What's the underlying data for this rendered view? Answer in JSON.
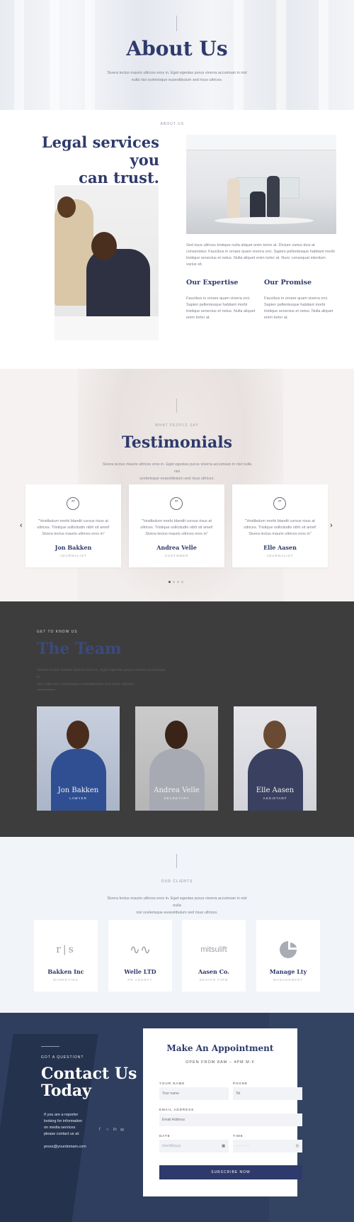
{
  "hero": {
    "title": "About Us",
    "subtitle_line1": "Sivera lectus mauris ultrices eros in. Eget egestas purus viverra accumsan in nisl",
    "subtitle_line2": "nulla nisi scelerisque eusestibulum sed risus ultrices."
  },
  "about": {
    "eyebrow": "ABOUT US",
    "title_line1": "Legal services you",
    "title_line2": "can trust.",
    "body": "Sed risus ultrices tristique nulla aliquet enim tortor at. Dictum varius duis at consectetur. Faucibus in ornare quam viverra orci. Sapien pellentesque habitant morbi tristique senectus et netus. Nulla aliquet enim tortor at. Nunc consequat interdum varius sit.",
    "col1": {
      "title": "Our Expertise",
      "body": "Faucibus in ornare quam viverra orci. Sapien pellentesque habitant morbi tristique senectus et netus. Nulla aliquet enim tortor at."
    },
    "col2": {
      "title": "Our Promise",
      "body": "Faucibus in ornare quam viverra orci. Sapien pellentesque habitant morbi tristique senectus et netus. Nulla aliquet enim tortor at."
    }
  },
  "testimonials": {
    "eyebrow": "WHAT PEOPLE SAY",
    "title": "Testimonials",
    "intro_line1": "Sivera lectus mauris ultrices eros in. Eget egestas purus viverra accumsan in nisl nulla nisi",
    "intro_line2": "scelerisque eusestibulum sed risus ultrices.",
    "prev_icon": "chevron-left-icon",
    "next_icon": "chevron-right-icon",
    "quote_glyph": "”",
    "items": [
      {
        "quote": "\"Vestibulum morbi blandit cursus risus at ultrices. Tristique sollicitudin nibh sit amet! Sivera lectus mauris ultrices eros in\"",
        "name": "Jon Bakken",
        "role": "JOURNALIST"
      },
      {
        "quote": "\"Vestibulum morbi blandit cursus risus at ultrices. Tristique sollicitudin nibh sit amet! Sivera lectus mauris ultrices eros in\"",
        "name": "Andrea Velle",
        "role": "CUSTOMER"
      },
      {
        "quote": "\"Vestibulum morbi blandit cursus risus at ultrices. Tristique sollicitudin nibh sit amet! Sivera lectus mauris ultrices eros in\"",
        "name": "Elle Aasen",
        "role": "JOURNALIST"
      }
    ],
    "pager": {
      "total": 4,
      "active": 1
    }
  },
  "team": {
    "eyebrow": "GET TO KNOW US",
    "title": "The Team",
    "intro_line1": "Sivera lectus mauris ultrices eros in. Eget egestas purus viverra accumsan in",
    "intro_line2": "nisl nulla nisi scelerisque eusestibulum sed risus ultrices.",
    "members": [
      {
        "name": "Jon Bakken",
        "role": "LAWYER"
      },
      {
        "name": "Andrea Velle",
        "role": "SECRETARY"
      },
      {
        "name": "Elle Aasen",
        "role": "ASSISTANT"
      }
    ]
  },
  "clients": {
    "eyebrow": "OUR CLIENTS",
    "intro_line1": "Sivera lectus mauris ultrices eros in. Eget egestas purus viverra accumsan in nisl nulla",
    "intro_line2": "nisi scelerisque eusestibulum sed risus ultrices.",
    "items": [
      {
        "logo": "r|s",
        "name": "Bakken Inc",
        "type": "MARKETING"
      },
      {
        "logo": "∿∿",
        "name": "Welle LTD",
        "type": "PR AGENCY"
      },
      {
        "logo": "mitsulift",
        "name": "Aasen Co.",
        "type": "DESIGN FIRM"
      },
      {
        "logo": "",
        "name": "Manage Lty",
        "type": "MANAGEMENT"
      }
    ]
  },
  "contact": {
    "eyebrow": "GOT A QUESTION?",
    "title_line1": "Contact Us",
    "title_line2": "Today",
    "lead": "If you are a reporter looking for information on media services please contact us at:",
    "email": "press@yourdomain.com",
    "social_icons": [
      "facebook-icon",
      "instagram-icon",
      "linkedin-icon",
      "mail-icon"
    ],
    "form": {
      "title": "Make An Appointment",
      "hours": "OPEN FROM 8AM – 4PM M-F",
      "name_label": "YOUR NAME",
      "name_placeholder": "Your name",
      "phone_label": "PHONE",
      "phone_placeholder": "Tel",
      "email_label": "EMAIL ADDRESS",
      "email_placeholder": "Email Address",
      "date_label": "DATE",
      "date_placeholder": "mm/dd/yyyy",
      "time_label": "TIME",
      "time_placeholder": "- - : - -  - -",
      "submit": "SUBSCRIBE NOW"
    }
  },
  "colors": {
    "navy": "#2e3a6b",
    "dark_bg": "#3d3d3d",
    "contact_bg": "#2f3e5e",
    "light_bg": "#f1f4f8"
  }
}
